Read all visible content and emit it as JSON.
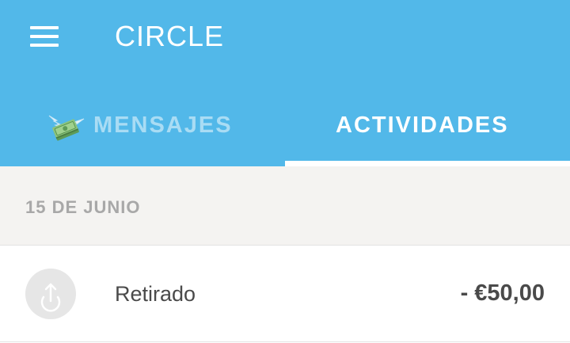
{
  "app": {
    "title": "CIRCLE"
  },
  "icons": {
    "menu": "hamburger-menu-icon",
    "messages_tab": "flying-money-icon",
    "activity": "upload-arrow-icon"
  },
  "colors": {
    "appbar": "#52b8e9",
    "tab_inactive": "#a9dcf4",
    "tab_active": "#ffffff",
    "date_header_bg": "#f4f3f1",
    "date_text": "#a8a8a8",
    "text_dark": "#4a4a4a"
  },
  "tabs": [
    {
      "label": "MENSAJES",
      "active": false
    },
    {
      "label": "ACTIVIDADES",
      "active": true
    }
  ],
  "activity": {
    "date_header": "15 DE JUNIO",
    "items": [
      {
        "label": "Retirado",
        "amount": "- €50,00"
      }
    ]
  }
}
